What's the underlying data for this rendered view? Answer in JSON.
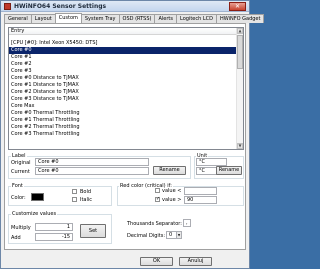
{
  "window": {
    "title": "HWiNFO64 Sensor Settings",
    "close_label": "✕"
  },
  "tabs": [
    "General",
    "Layout",
    "Custom",
    "System Tray",
    "OSD (RTSS)",
    "Alerts",
    "Logitech LCD",
    "HWiNFO Gadget"
  ],
  "active_tab": "Custom",
  "list": {
    "header": "Entry",
    "rows": [
      "[CPU [#0]: Intel Xeon X5450: DTS]",
      "Core #0",
      "Core #1",
      "Core #2",
      "Core #3",
      "Core #0 Distance to TjMAX",
      "Core #1 Distance to TjMAX",
      "Core #2 Distance to TjMAX",
      "Core #3 Distance to TjMAX",
      "Core Max",
      "Core #0 Thermal Throttling",
      "Core #1 Thermal Throttling",
      "Core #2 Thermal Throttling",
      "Core #3 Thermal Throttling"
    ],
    "selected_index": 1
  },
  "label_group": {
    "title": "Label",
    "original_label": "Original",
    "original_value": "Core #0",
    "current_label": "Current",
    "current_value": "Core #0",
    "rename_label": "Rename"
  },
  "unit_group": {
    "title": "Unit",
    "original_value": "°C",
    "current_value": "°C",
    "rename_label": "Rename"
  },
  "font_group": {
    "title": "Font",
    "color_label": "Color:",
    "bold_label": "Bold",
    "italic_label": "Italic",
    "swatch_color": "#000000"
  },
  "red_color_group": {
    "title": "Red color (critical) if:",
    "less_label": "value <",
    "less_checked": false,
    "less_value": "",
    "greater_label": "value >",
    "greater_checked": true,
    "greater_value": "90"
  },
  "customize_group": {
    "title": "Customize values",
    "multiply_label": "Multiply",
    "multiply_value": "1",
    "add_label": "Add",
    "add_value": "-15",
    "set_label": "Set"
  },
  "format": {
    "thousands_label": "Thousands Separator:",
    "thousands_value": ",",
    "decimal_label": "Decimal Digits:",
    "decimal_value": "0"
  },
  "footer": {
    "ok_label": "OK",
    "cancel_label": "Anuluj"
  }
}
